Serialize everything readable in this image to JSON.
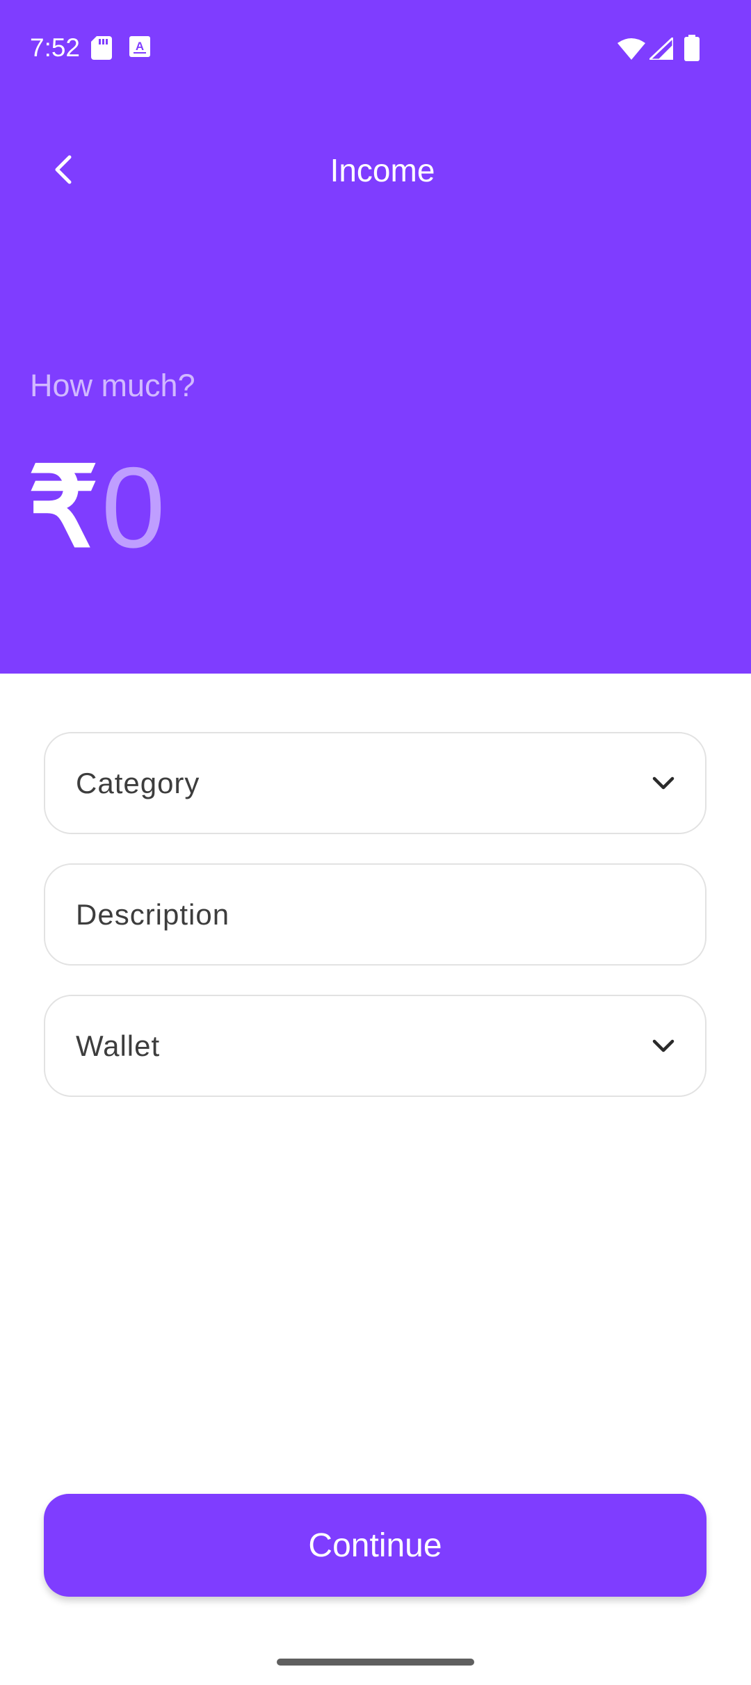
{
  "status_bar": {
    "time": "7:52",
    "icons": [
      "sd-card-icon",
      "keyboard-app-icon",
      "wifi-icon",
      "cellular-signal-icon",
      "battery-icon"
    ]
  },
  "app_bar": {
    "title": "Income",
    "back_icon": "back-arrow-icon"
  },
  "amount": {
    "label": "How much?",
    "currency_symbol": "₹",
    "value": "0"
  },
  "form": {
    "category": {
      "placeholder": "Category",
      "icon": "chevron-down-icon"
    },
    "description": {
      "placeholder": "Description"
    },
    "wallet": {
      "placeholder": "Wallet",
      "icon": "chevron-down-icon"
    }
  },
  "actions": {
    "continue_label": "Continue"
  },
  "colors": {
    "primary": "#7F3DFF",
    "surface": "#FFFFFF",
    "field_border": "#E2E2E2"
  }
}
